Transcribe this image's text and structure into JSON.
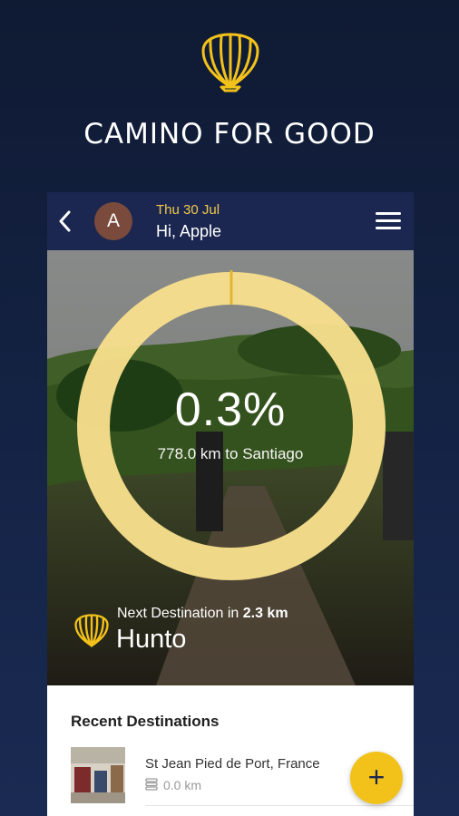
{
  "app": {
    "title": "CAMINO FOR GOOD"
  },
  "header": {
    "avatar_initial": "A",
    "date": "Thu 30 Jul",
    "greeting": "Hi, Apple"
  },
  "progress": {
    "percent_text": "0.3%",
    "percent_value": 0.003,
    "distance_text": "778.0 km to Santiago"
  },
  "next_destination": {
    "prefix": "Next Destination in ",
    "distance": "2.3 km",
    "name": "Hunto"
  },
  "recent": {
    "title": "Recent Destinations",
    "items": [
      {
        "name": "St Jean Pied de Port, France",
        "km": "0.0 km"
      }
    ]
  },
  "fab": {
    "label": "+"
  },
  "colors": {
    "navy": "#1b2750",
    "gold": "#f2c21a",
    "ring": "#f7df8c"
  }
}
